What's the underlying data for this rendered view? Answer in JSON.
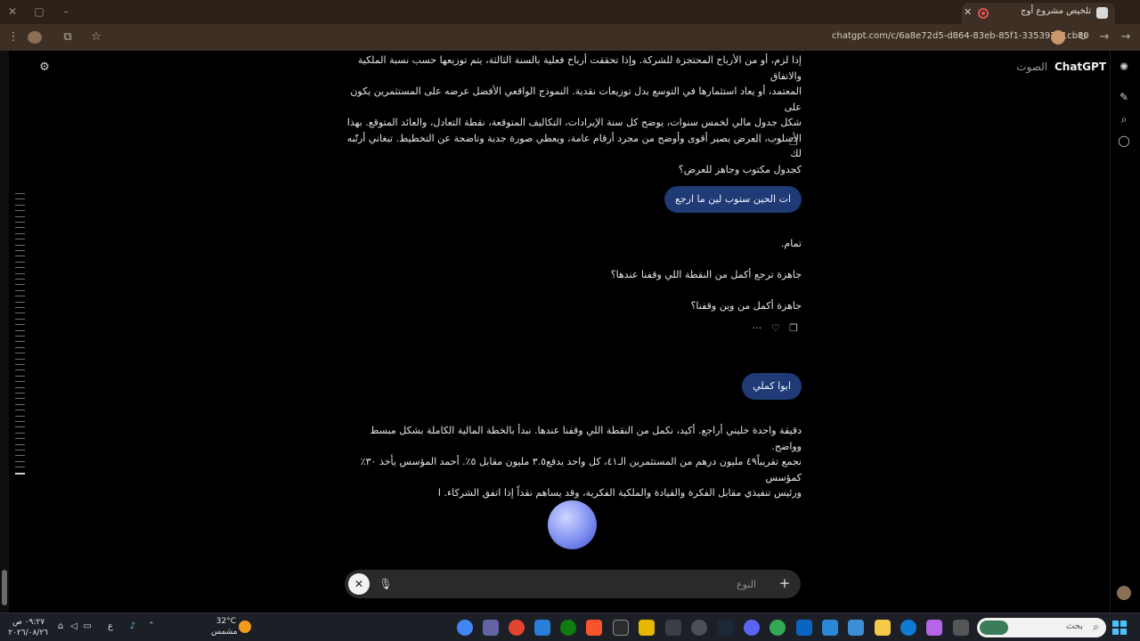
{
  "browser": {
    "tab_title": "تلخيص مشروع أوج",
    "url": "chatgpt.com/c/6a8e72d5-d864-83eb-85f1-335397a1cb80"
  },
  "header": {
    "brand": "ChatGPT",
    "mode": "الصوت"
  },
  "conversation": {
    "assistant_1": {
      "lines": [
        "إذا لزم، أو من الأرباح المحتجزة للشركة. وإذا تحققت أرباح فعلية بالسنة الثالثة، يتم توزيعها حسب نسبة الملكية والاتفاق",
        "المعتمد، أو يعاد استثمارها في التوسع بدل توزيعات نقدية. النموذج الواقعي الأفضل عرضه على المستثمرين يكون على",
        "شكل جدول مالي لخمس سنوات، يوضح كل سنة الإيرادات، التكاليف المتوقعة، نقطة التعادل، والعائد المتوقع. بهذا",
        "الأسلوب، العرض يصير أقوى وأوضح من مجرد أرقام عامة، ويعطي صورة جدية وتاضحة عن التخطيط. تبغاني أرتّبه لك",
        "كجدول مكتوب وجاهز للعرض؟"
      ]
    },
    "user_1": "ات الحين ستوب لين ما ارجع",
    "assistant_2": {
      "lines": [
        "تمام.",
        "",
        "جاهزة ترجع أكمل من النقطة اللي وقفنا عندها؟",
        "",
        "جاهزة أكمل من وين وقفنا؟"
      ]
    },
    "user_2": "ايوا كملي",
    "assistant_3": {
      "lines": [
        "دقيقة واحدة خليني أراجع. أكيد، نكمل من النقطة اللي وقفنا عندها. نبدأ بالخطة المالية الكاملة بشكل مبسط وواضح.",
        "نجمع تقريباً٤٩ مليون درهم من المستثمرين الـ٤١، كل واحد يدفع٣.٥ مليون مقابل ٥٪. أحمد المؤسس يأخذ ٣٠٪ كمؤسس",
        "ورئيس تنفيذي مقابل الفكرة والقيادة والملكية الفكرية، وقد يساهم نقداً إذا اتفق الشركاء. ا"
      ]
    }
  },
  "composer": {
    "placeholder": "النوع"
  },
  "taskbar": {
    "search_placeholder": "بحث",
    "weather_temp": "32°C",
    "weather_desc": "مشمس",
    "clock_time": "٠٩:٢٧ ص",
    "clock_date": "٢٠٢٦/٠٨/٢٦",
    "lang": "ع"
  },
  "icons": {
    "brand_logo": "openai-logo-icon",
    "settings": "sliders-icon",
    "copy": "copy-icon",
    "dislike": "thumbs-down-icon",
    "more": "more-dots-icon",
    "mic_off": "mic-off-icon",
    "close": "close-icon",
    "plus": "plus-icon"
  },
  "colors": {
    "user_bubble": "#1f3a74",
    "voice_orb": "#8e9cf5",
    "browser_chrome": "#3d2f24"
  }
}
